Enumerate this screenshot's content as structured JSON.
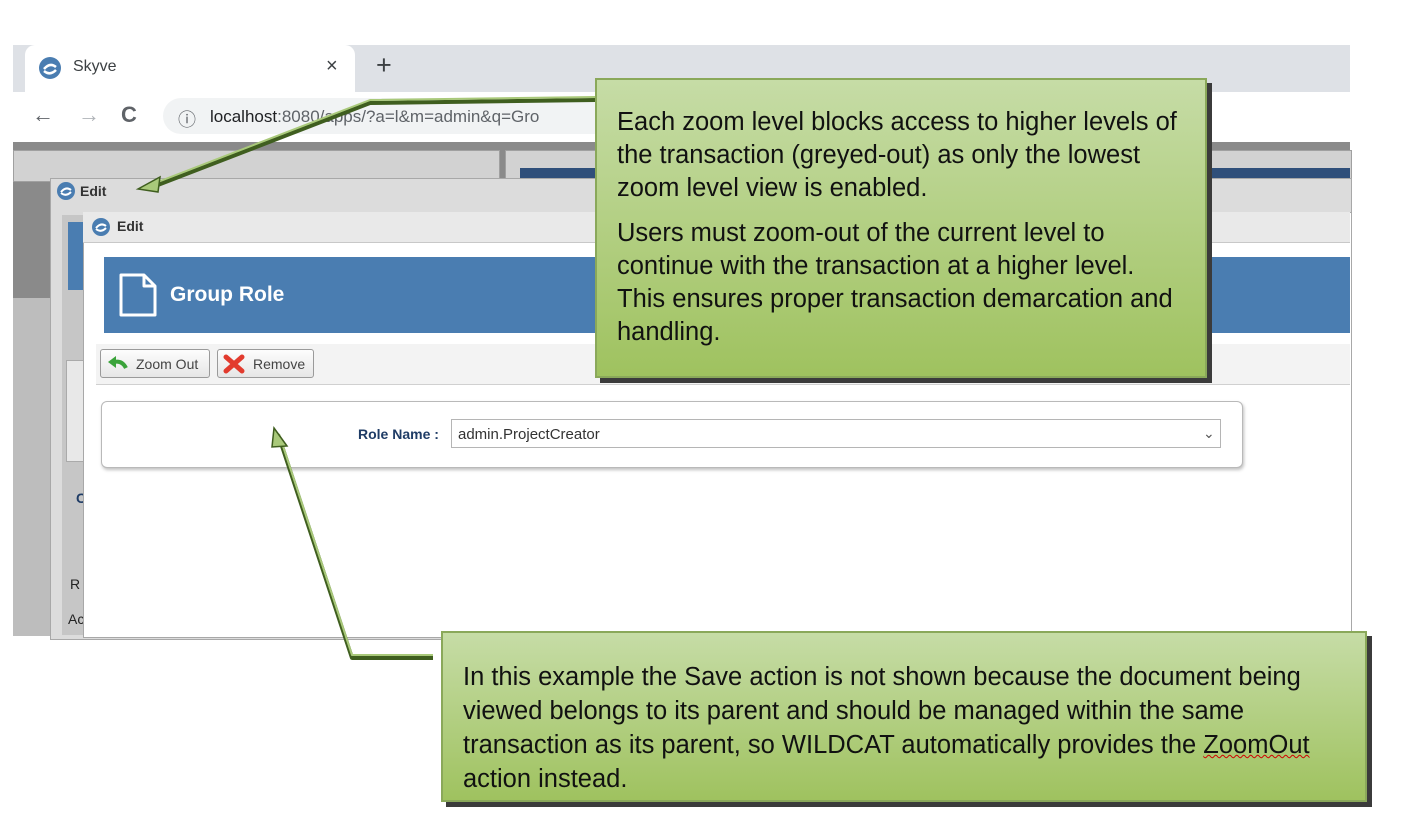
{
  "browser": {
    "tab_title": "Skyve",
    "tab_close": "×",
    "new_tab": "+",
    "back": "←",
    "forward": "→",
    "reload": "C",
    "info": "ⓘ",
    "url_host": "localhost",
    "url_rest": ":8080/apps/?a=l&m=admin&q=Gro"
  },
  "outer_window": {
    "title": "Edit"
  },
  "inner_window": {
    "title": "Edit",
    "banner_title": "Group Role",
    "buttons": [
      {
        "label": "Zoom Out"
      },
      {
        "label": "Remove"
      }
    ],
    "form": {
      "role_label": "Role Name :",
      "role_value": "admin.ProjectCreator"
    }
  },
  "background_slivers": {
    "c": "C",
    "r": "R",
    "ac": "Ac"
  },
  "callouts": {
    "top_p1": "Each zoom level blocks access to higher levels of the transaction (greyed-out) as only the lowest zoom level view is enabled.",
    "top_p2": "Users must zoom-out of the current level to continue with the transaction at a higher level. This ensures proper transaction demarcation and handling.",
    "bottom_before": "In this example the Save action is not shown because the document being viewed belongs to its parent and should be managed within the same transaction as its parent, so WILDCAT automatically provides the ",
    "bottom_word": "ZoomOut",
    "bottom_after": " action instead."
  },
  "colors": {
    "banner": "#4a7db1",
    "callout_light": "#c6dca6",
    "callout_dark": "#9fc25f",
    "arrow": "#3f5e1f"
  }
}
